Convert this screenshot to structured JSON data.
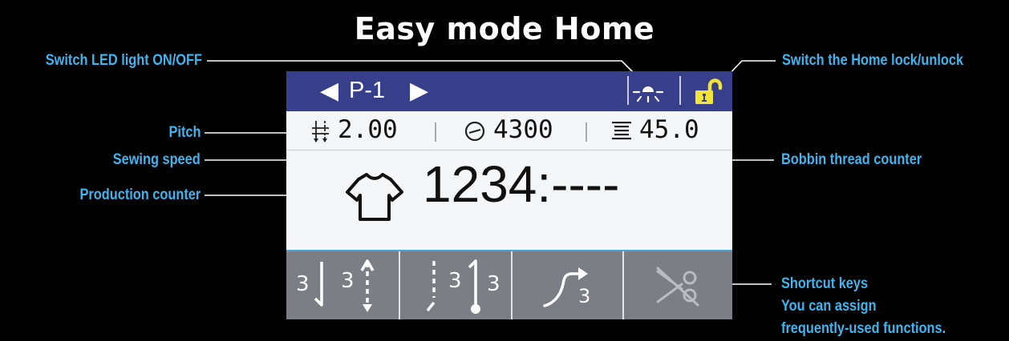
{
  "title": "Easy mode Home",
  "callouts": {
    "led": "Switch LED light ON/OFF",
    "lock": "Switch the Home lock/unlock",
    "pitch": "Pitch",
    "speed": "Sewing speed",
    "bobbin": "Bobbin thread counter",
    "production": "Production counter",
    "shortcut_1": "Shortcut keys",
    "shortcut_2": "You can assign",
    "shortcut_3": "frequently-used functions."
  },
  "screen": {
    "pattern": "P-1",
    "pitch": "2.00",
    "speed": "4300",
    "bobbin": "45.0",
    "production": "1234:----",
    "shortcut_digit": "3"
  },
  "colors": {
    "background": "#000000",
    "callout": "#3fb5f0",
    "header": "#383f8a",
    "screen": "#f5f6f8",
    "keys": "#7b7e85",
    "lock": "#f2e43a"
  },
  "icons": [
    "left-arrow-icon",
    "right-arrow-icon",
    "led-light-icon",
    "unlock-icon",
    "pitch-icon",
    "speed-icon",
    "bobbin-icon",
    "shirt-icon",
    "reverse-start-icon",
    "reverse-end-icon",
    "condensed-stitch-icon",
    "thread-trim-icon"
  ]
}
